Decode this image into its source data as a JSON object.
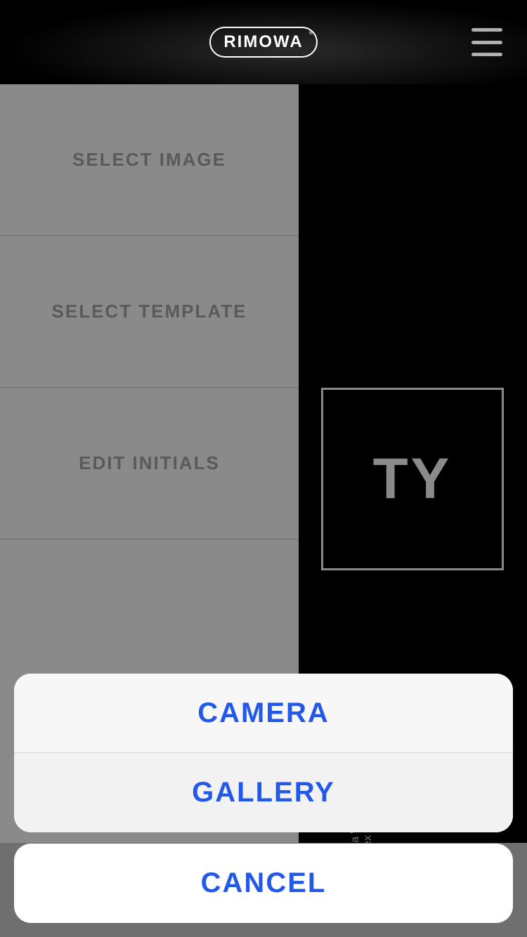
{
  "header": {
    "brand": "RIMOWA"
  },
  "sidebar": {
    "items": [
      {
        "label": "SELECT IMAGE"
      },
      {
        "label": "SELECT TEMPLATE"
      },
      {
        "label": "EDIT INITIALS"
      }
    ]
  },
  "preview": {
    "initials": "TY"
  },
  "action_sheet": {
    "options": [
      {
        "label": "CAMERA"
      },
      {
        "label": "GALLERY"
      }
    ],
    "cancel": "CANCEL"
  }
}
